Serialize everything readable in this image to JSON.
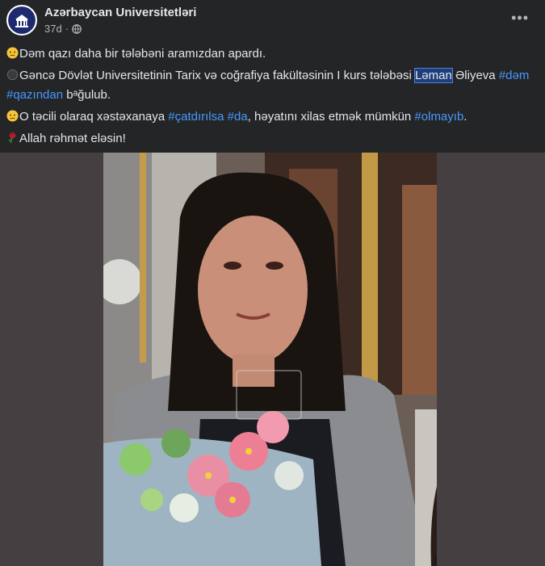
{
  "post": {
    "author": "Azərbaycan Universitetləri",
    "time": "37d",
    "privacy_icon": "globe-icon",
    "more_icon": "more-dots-icon",
    "more_label": "•••",
    "lines": {
      "l1": "Dəm qazı daha bir tələbəni aramızdan apardı.",
      "l2_a": "Gəncə Dövlət Universitetinin Tarix və coğrafiya fakültəsinin I kurs tələbəsi ",
      "l2_name": "Ləman",
      "l2_b": " Əliyeva ",
      "l2_tag1": "#dəm",
      "l3_tag": "#qazından",
      "l3_b": " bᵃğulub.",
      "l4_a": "O təcili olaraq xəstəxanaya ",
      "l4_tag1": "#çatdırılsa",
      "l4_sp": " ",
      "l4_tag2": "#da",
      "l4_b": ", həyatını xilas etmək mümkün ",
      "l4_tag3": "#olmayıb",
      "l4_c": ".",
      "l5": "Allah rəhmət eləsin!"
    },
    "emojis": [
      "sad-face-icon",
      "black-circle-icon",
      "sad-face-icon",
      "rose-icon"
    ]
  },
  "colors": {
    "background": "#242526",
    "text": "#e4e6eb",
    "secondary": "#b0b3b8",
    "hashtag": "#4599ff",
    "media_bg": "#463f42"
  }
}
